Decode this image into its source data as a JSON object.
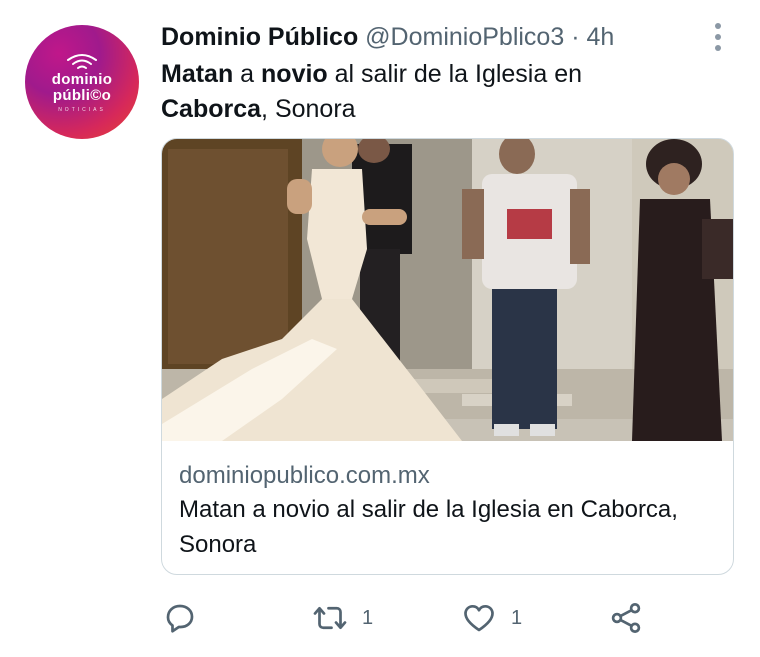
{
  "author": {
    "name": "Dominio Público",
    "handle": "@DominioPblico3",
    "separator": "·",
    "time": "4h",
    "avatar": {
      "line1": "dominio",
      "line2": "públi©o",
      "tag": "NOTICIAS",
      "gradient_start": "#c0178a",
      "gradient_end": "#e8452f"
    }
  },
  "tweet": {
    "segments": [
      {
        "text": "Matan",
        "bold": true
      },
      {
        "text": " a ",
        "bold": false
      },
      {
        "text": "novio",
        "bold": true
      },
      {
        "text": " al salir de la Iglesia en ",
        "bold": false
      },
      {
        "text": "Caborca",
        "bold": true
      },
      {
        "text": ", Sonora",
        "bold": false
      }
    ]
  },
  "card": {
    "domain": "dominiopublico.com.mx",
    "title": "Matan a novio al salir de la Iglesia en Caborca, Sonora",
    "image_icon": "wedding-photo"
  },
  "actions": {
    "reply": {
      "icon": "reply-icon",
      "count": ""
    },
    "retweet": {
      "icon": "retweet-icon",
      "count": "1"
    },
    "like": {
      "icon": "heart-icon",
      "count": "1"
    },
    "share": {
      "icon": "share-icon",
      "count": ""
    }
  },
  "colors": {
    "text": "#0f1419",
    "secondary": "#536471",
    "border": "#cfd9de",
    "more_dots": "#8b98a5"
  }
}
